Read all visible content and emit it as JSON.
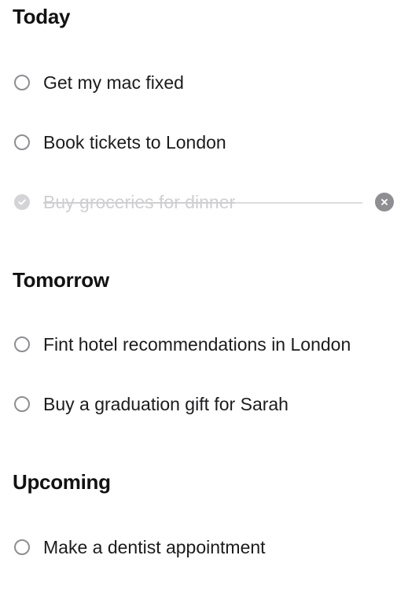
{
  "sections": [
    {
      "title": "Today",
      "tasks": [
        {
          "label": "Get my mac fixed",
          "completed": false
        },
        {
          "label": "Book tickets to London",
          "completed": false
        },
        {
          "label": "Buy groceries for dinner",
          "completed": true
        }
      ]
    },
    {
      "title": "Tomorrow",
      "tasks": [
        {
          "label": "Fint hotel recommendations in London",
          "completed": false
        },
        {
          "label": "Buy a graduation gift for Sarah",
          "completed": false
        }
      ]
    },
    {
      "title": "Upcoming",
      "tasks": [
        {
          "label": "Make a dentist appointment",
          "completed": false
        }
      ]
    }
  ],
  "icons": {
    "checkbox": "circle-icon",
    "completed_checkbox": "checkmark-circle-icon",
    "delete": "close-circle-icon"
  },
  "colors": {
    "checkbox_border": "#8e8e93",
    "completed_text": "#cfcfd2",
    "delete_button": "#8e8e93"
  }
}
